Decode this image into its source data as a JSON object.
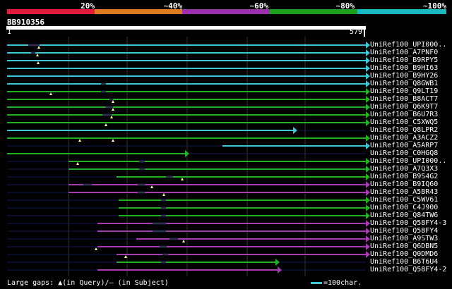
{
  "legend": {
    "labels": [
      "20%",
      "~40%",
      "~60%",
      "~80%",
      "~100%"
    ],
    "colors": [
      "#e01a3a",
      "#e07a1e",
      "#9b2fae",
      "#1fa01a",
      "#1ab8c0"
    ]
  },
  "query": {
    "name": "BB910356",
    "start": "1",
    "end": "579"
  },
  "hits": [
    {
      "label": "UniRef100_UPI000..",
      "color": "#3bc7d6"
    },
    {
      "label": "UniRef100_A7PNF0",
      "color": "#3bc7d6"
    },
    {
      "label": "UniRef100_B9RPY5",
      "color": "#3bc7d6"
    },
    {
      "label": "UniRef100_B9HI63",
      "color": "#3bc7d6"
    },
    {
      "label": "UniRef100_B9HY26",
      "color": "#3bc7d6"
    },
    {
      "label": "UniRef100_Q8GWB1",
      "color": "#3bc7d6"
    },
    {
      "label": "UniRef100_Q9LT19",
      "color": "#22b022"
    },
    {
      "label": "UniRef100_B8ACT7",
      "color": "#22b022"
    },
    {
      "label": "UniRef100_Q6K9T7",
      "color": "#22b022"
    },
    {
      "label": "UniRef100_B6U7R3",
      "color": "#22b022"
    },
    {
      "label": "UniRef100_C5XWQ5",
      "color": "#22b022"
    },
    {
      "label": "UniRef100_Q8LPR2",
      "color": "#3bc7d6"
    },
    {
      "label": "UniRef100_A3ACZ2",
      "color": "#22b022"
    },
    {
      "label": "UniRef100_A5ARP7",
      "color": "#3bc7d6"
    },
    {
      "label": "UniRef100_C0HGQ8",
      "color": "#22b022"
    },
    {
      "label": "UniRef100_UPI000..",
      "color": "#22b022"
    },
    {
      "label": "UniRef100_A7Q3X3",
      "color": "#22b022"
    },
    {
      "label": "UniRef100_B9S4G2",
      "color": "#22b022"
    },
    {
      "label": "UniRef100_B9IQ60",
      "color": "#a63ab3"
    },
    {
      "label": "UniRef100_A5BR43",
      "color": "#a63ab3"
    },
    {
      "label": "UniRef100_C5WV61",
      "color": "#22b022"
    },
    {
      "label": "UniRef100_C4J900",
      "color": "#22b022"
    },
    {
      "label": "UniRef100_Q84TW6",
      "color": "#22b022"
    },
    {
      "label": "UniRef100_Q58FY4-3",
      "color": "#a63ab3"
    },
    {
      "label": "UniRef100_Q58FY4",
      "color": "#a63ab3"
    },
    {
      "label": "UniRef100_A9STW3",
      "color": "#a63ab3"
    },
    {
      "label": "UniRef100_Q6DBN5",
      "color": "#a63ab3"
    },
    {
      "label": "UniRef100_Q0DMD6",
      "color": "#a63ab3"
    },
    {
      "label": "UniRef100_B6T6U4",
      "color": "#22b022"
    },
    {
      "label": "UniRef100_Q58FY4-2",
      "color": "#a63ab3"
    }
  ],
  "footer": {
    "gaps_text": "Large gaps: ▲(in Query)/– (in Subject)",
    "scale_text": "=100char."
  }
}
